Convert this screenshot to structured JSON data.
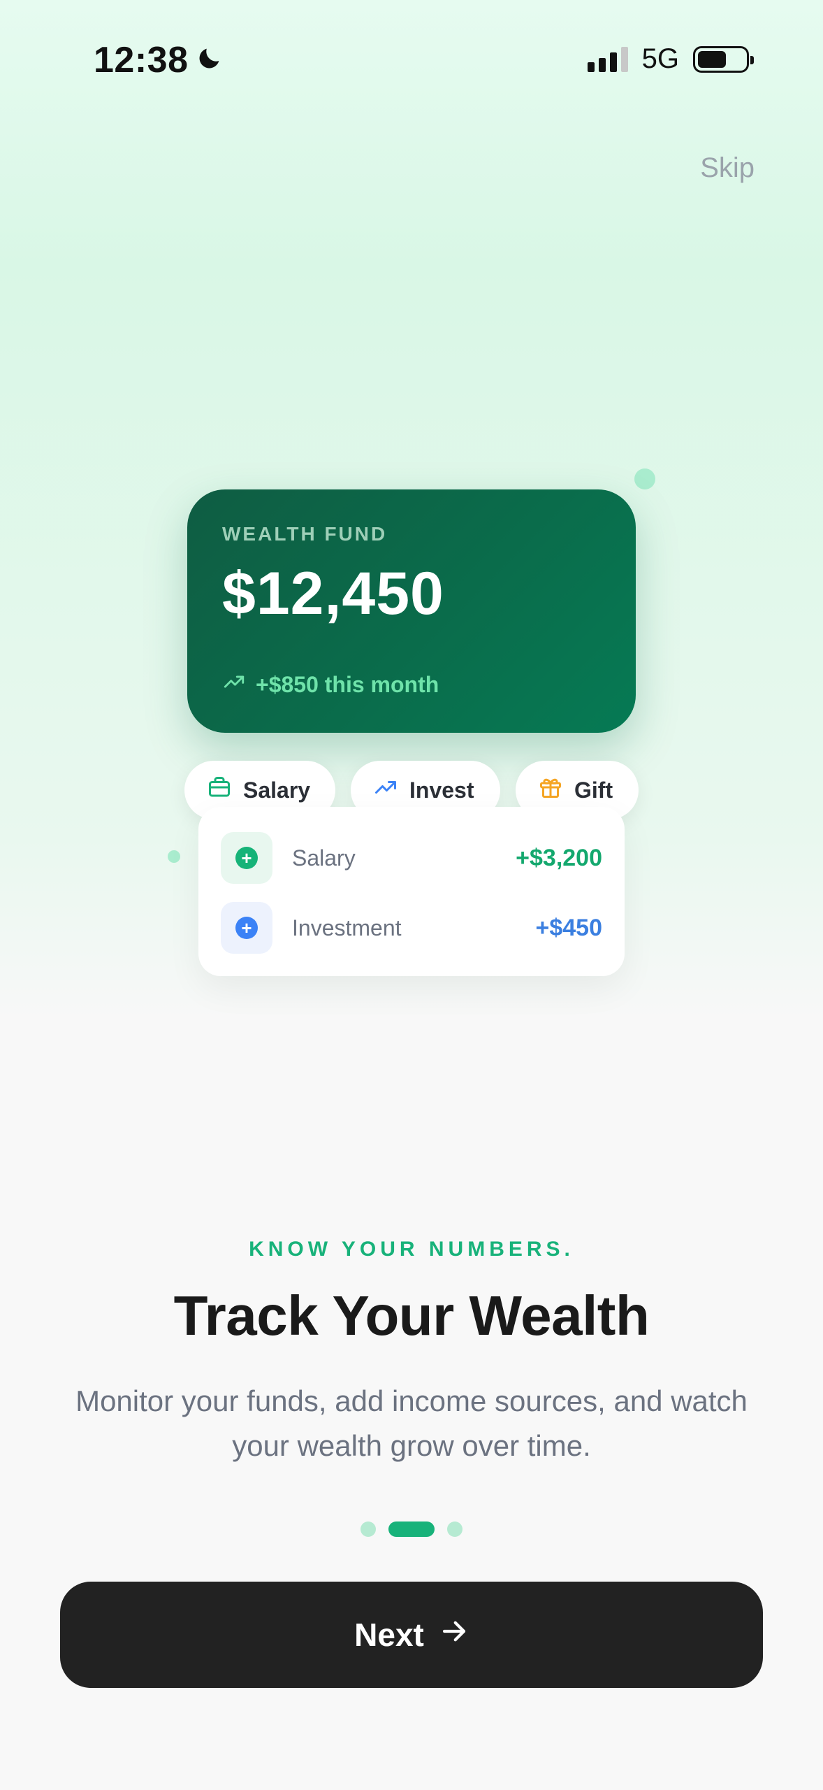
{
  "status_bar": {
    "time": "12:38",
    "network": "5G",
    "icons": [
      "moon-icon",
      "signal-icon",
      "battery-icon"
    ]
  },
  "header": {
    "skip_label": "Skip"
  },
  "wealth_card": {
    "label": "WEALTH FUND",
    "amount": "$12,450",
    "growth": "+$850 this month",
    "growth_icon": "trending-up-icon",
    "colors": {
      "start": "#0f5d43",
      "end": "#067a54",
      "growth_text": "#6fe3aa"
    }
  },
  "chips": [
    {
      "label": "Salary",
      "icon": "briefcase-icon",
      "color": "#18b27a"
    },
    {
      "label": "Invest",
      "icon": "trending-up-icon",
      "color": "#3b82f6"
    },
    {
      "label": "Gift",
      "icon": "gift-icon",
      "color": "#f5a524"
    }
  ],
  "transactions": [
    {
      "label": "Salary",
      "amount": "+$3,200",
      "color": "#14a86e"
    },
    {
      "label": "Investment",
      "amount": "+$450",
      "color": "#3b7fe0"
    }
  ],
  "onboarding": {
    "eyebrow": "KNOW YOUR NUMBERS.",
    "title": "Track Your Wealth",
    "description": "Monitor your funds, add income sources, and watch your wealth grow over time.",
    "page_index": 2,
    "page_count": 3
  },
  "cta": {
    "next_label": "Next",
    "icon": "arrow-right-icon"
  },
  "accent_color": "#18b27a"
}
